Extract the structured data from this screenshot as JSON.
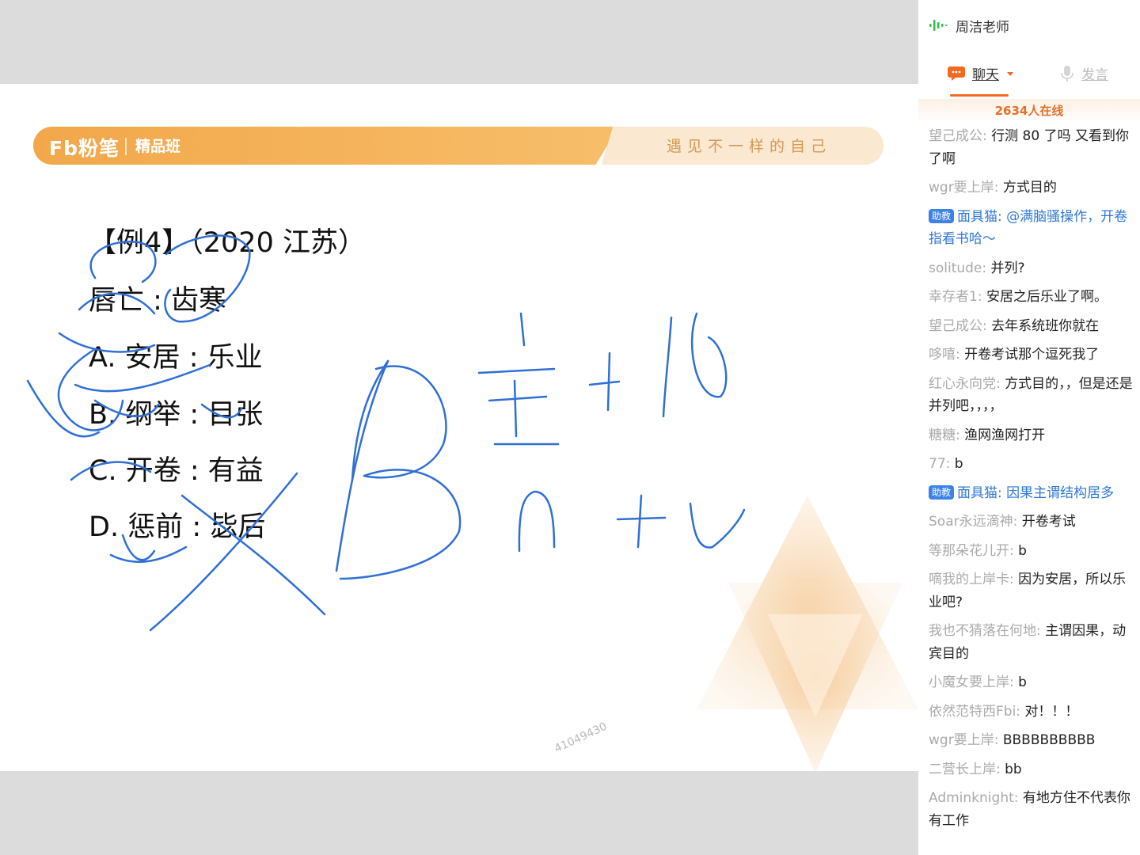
{
  "banner": {
    "logo": "Fb粉笔",
    "class_name": "精品班",
    "slogan": "遇见不一样的自己"
  },
  "question": {
    "title": "【例4】（2020 江苏）",
    "stem": "唇亡 : 齿寒",
    "options": [
      "A. 安居 : 乐业",
      "B. 纲举 : 目张",
      "C. 开卷 : 有益",
      "D. 惩前 : 毖后"
    ]
  },
  "watermark": "41049430",
  "sidebar": {
    "teacher": "周洁老师",
    "tabs": {
      "chat": "聊天",
      "speak": "发言"
    },
    "online": "2634人在线",
    "assistant_badge": "助教",
    "messages": [
      {
        "nick": "望己成公",
        "text": "行测 80 了吗 又看到你了啊",
        "assistant": false
      },
      {
        "nick": "wgr要上岸",
        "text": "方式目的",
        "assistant": false
      },
      {
        "nick": "面具猫",
        "text": "@满脑骚操作，开卷指看书哈～",
        "assistant": true
      },
      {
        "nick": "solitude",
        "text": "并列?",
        "assistant": false
      },
      {
        "nick": "幸存者1",
        "text": "安居之后乐业了啊。",
        "assistant": false
      },
      {
        "nick": "望己成公",
        "text": "去年系统班你就在",
        "assistant": false
      },
      {
        "nick": "哆嘻",
        "text": "开卷考试那个逗死我了",
        "assistant": false
      },
      {
        "nick": "红心永向党",
        "text": "方式目的，，但是还是并列吧，，，，",
        "assistant": false
      },
      {
        "nick": "糖糖",
        "text": "渔网渔网打开",
        "assistant": false
      },
      {
        "nick": "77",
        "text": "b",
        "assistant": false
      },
      {
        "nick": "面具猫",
        "text": "因果主谓结构居多",
        "assistant": true
      },
      {
        "nick": "Soar永远滴神",
        "text": "开卷考试",
        "assistant": false
      },
      {
        "nick": "等那朵花儿开",
        "text": "b",
        "assistant": false
      },
      {
        "nick": "嘀我的上岸卡",
        "text": "因为安居，所以乐业吧?",
        "assistant": false
      },
      {
        "nick": "我也不猜落在何地",
        "text": "主谓因果，动宾目的",
        "assistant": false
      },
      {
        "nick": "小魔女要上岸",
        "text": "b",
        "assistant": false
      },
      {
        "nick": "依然范特西Fbi",
        "text": "对！！！",
        "assistant": false
      },
      {
        "nick": "wgr要上岸",
        "text": "BBBBBBBBBB",
        "assistant": false
      },
      {
        "nick": "二营长上岸",
        "text": "bb",
        "assistant": false
      },
      {
        "nick": "Adminknight",
        "text": "有地方住不代表你有工作",
        "assistant": false
      }
    ]
  },
  "colors": {
    "accent": "#f26a21",
    "banner": "#f2a74a",
    "ink": "#2f6fd6",
    "assistant": "#2f78d6"
  }
}
